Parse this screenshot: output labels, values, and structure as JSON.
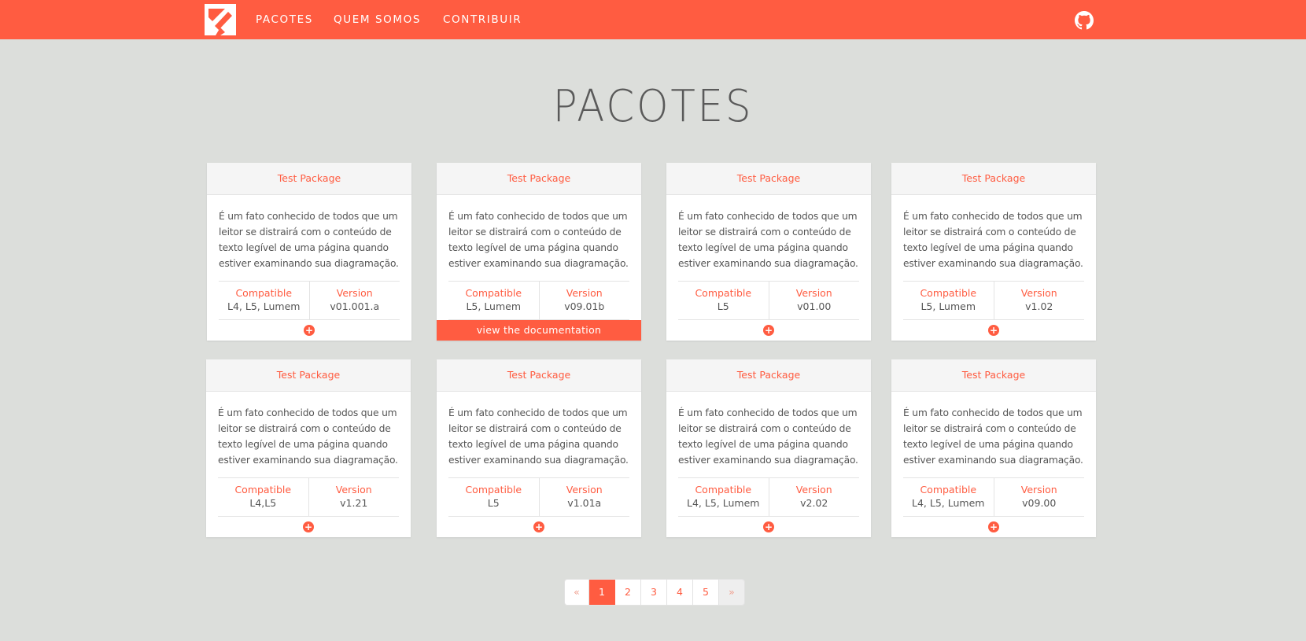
{
  "nav": {
    "logo": "logo-icon",
    "links": [
      "PACOTES",
      "QUEM SOMOS",
      "CONTRIBUIR"
    ],
    "github": "github-icon",
    "brand_color": "#ff5c41"
  },
  "page_title": "PACOTES",
  "packages": [
    {
      "name": "Test Package",
      "description": "É um fato conhecido de todos que um leitor se distrairá com o conteúdo de texto legível de uma página quando estiver examinando sua diagramação.",
      "compatible_label": "Compatible",
      "compatible": "L4, L5, Lumem",
      "version_label": "Version",
      "version": "v01.001.a"
    },
    {
      "name": "Test Package",
      "description": "É um fato conhecido de todos que um leitor se distrairá com o conteúdo de texto legível de uma página quando estiver examinando sua diagramação.",
      "compatible_label": "Compatible",
      "compatible": "L5, Lumem",
      "version_label": "Version",
      "version": "v09.01b",
      "doc_label": "view the documentation"
    },
    {
      "name": "Test Package",
      "description": "É um fato conhecido de todos que um leitor se distrairá com o conteúdo de texto legível de uma página quando estiver examinando sua diagramação.",
      "compatible_label": "Compatible",
      "compatible": "L5",
      "version_label": "Version",
      "version": "v01.00"
    },
    {
      "name": "Test Package",
      "description": "É um fato conhecido de todos que um leitor se distrairá com o conteúdo de texto legível de uma página quando estiver examinando sua diagramação.",
      "compatible_label": "Compatible",
      "compatible": "L5, Lumem",
      "version_label": "Version",
      "version": "v1.02"
    },
    {
      "name": "Test Package",
      "description": "É um fato conhecido de todos que um leitor se distrairá com o conteúdo de texto legível de uma página quando estiver examinando sua diagramação.",
      "compatible_label": "Compatible",
      "compatible": "L4,L5",
      "version_label": "Version",
      "version": "v1.21"
    },
    {
      "name": "Test Package",
      "description": "É um fato conhecido de todos que um leitor se distrairá com o conteúdo de texto legível de uma página quando estiver examinando sua diagramação.",
      "compatible_label": "Compatible",
      "compatible": "L5",
      "version_label": "Version",
      "version": "v1.01a"
    },
    {
      "name": "Test Package",
      "description": "É um fato conhecido de todos que um leitor se distrairá com o conteúdo de texto legível de uma página quando estiver examinando sua diagramação.",
      "compatible_label": "Compatible",
      "compatible": "L4, L5, Lumem",
      "version_label": "Version",
      "version": "v2.02"
    },
    {
      "name": "Test Package",
      "description": "É um fato conhecido de todos que um leitor se distrairá com o conteúdo de texto legível de uma página quando estiver examinando sua diagramação.",
      "compatible_label": "Compatible",
      "compatible": "L4, L5, Lumem",
      "version_label": "Version",
      "version": "v09.00"
    }
  ],
  "pagination": {
    "prev": "«",
    "pages": [
      "1",
      "2",
      "3",
      "4",
      "5"
    ],
    "next": "»",
    "active_page": "1"
  },
  "icons": {
    "plus": "+"
  }
}
